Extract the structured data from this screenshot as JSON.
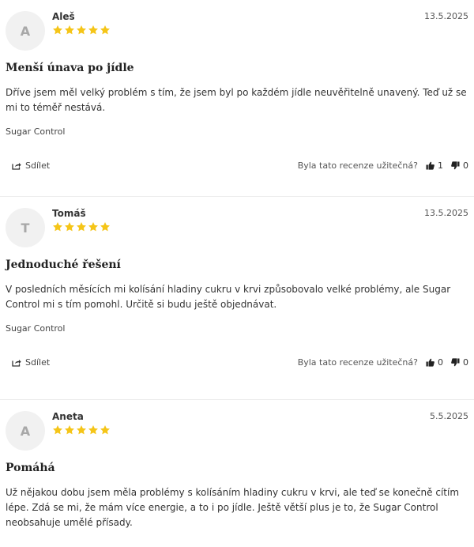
{
  "colors": {
    "star": "#f5c518",
    "avatar_bg": "#f1f1f1",
    "avatar_text": "#a8a8a8",
    "divider": "#ececec"
  },
  "labels": {
    "share": "Sdílet",
    "helpful_question": "Byla tato recenze užitečná?"
  },
  "icons": {
    "share": "share-icon",
    "up": "thumbs-up-icon",
    "down": "thumbs-down-icon",
    "star": "star-icon"
  },
  "reviews": [
    {
      "initial": "A",
      "author": "Aleš",
      "rating": 5,
      "date": "13.5.2025",
      "title": "Menší únava po jídle",
      "text": "Dříve jsem měl velký problém s tím, že jsem byl po každém jídle neuvěřitelně unavený. Teď už se mi to téměř nestává.",
      "product": "Sugar Control",
      "helpful_yes": "1",
      "helpful_no": "0"
    },
    {
      "initial": "T",
      "author": "Tomáš",
      "rating": 5,
      "date": "13.5.2025",
      "title": "Jednoduché řešení",
      "text": "V posledních měsících mi kolísání hladiny cukru v krvi způsobovalo velké problémy, ale Sugar Control mi s tím pomohl. Určitě si budu ještě objednávat.",
      "product": "Sugar Control",
      "helpful_yes": "0",
      "helpful_no": "0"
    },
    {
      "initial": "A",
      "author": "Aneta",
      "rating": 5,
      "date": "5.5.2025",
      "title": "Pomáhá",
      "text": "Už nějakou dobu jsem měla problémy s kolísáním hladiny cukru v krvi, ale teď se konečně cítím lépe. Zdá se mi, že mám více energie, a to i po jídle. Ještě větší plus je to, že Sugar Control neobsahuje umělé přísady."
    }
  ]
}
